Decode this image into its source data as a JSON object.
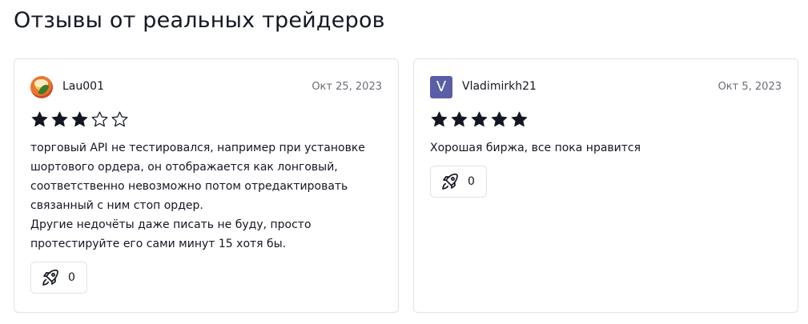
{
  "page": {
    "title": "Отзывы от реальных трейдеров"
  },
  "colors": {
    "text": "#131722",
    "muted": "#6a6d78",
    "border": "#e0e3eb",
    "avatar_letter_bg": "#5b5ea6"
  },
  "reviews": [
    {
      "author": "Lau001",
      "avatar": {
        "type": "photo-icon"
      },
      "date": "Окт 25, 2023",
      "rating": 3,
      "max_rating": 5,
      "text": "торговый API не тестировался, например при установке\nшортового ордера, он отображается как лонговый,\nсоответственно невозможно потом отредактировать\nсвязанный с ним стоп ордер.\nДругие недочёты даже писать не буду, просто\nпротестируйте его сами минут 15 хотя бы.",
      "boost_icon": "rocket-icon",
      "boost_count": "0"
    },
    {
      "author": "Vladimirkh21",
      "avatar": {
        "type": "letter",
        "letter": "V"
      },
      "date": "Окт 5, 2023",
      "rating": 5,
      "max_rating": 5,
      "text": "Хорошая биржа, все пока нравится",
      "boost_icon": "rocket-icon",
      "boost_count": "0"
    }
  ]
}
